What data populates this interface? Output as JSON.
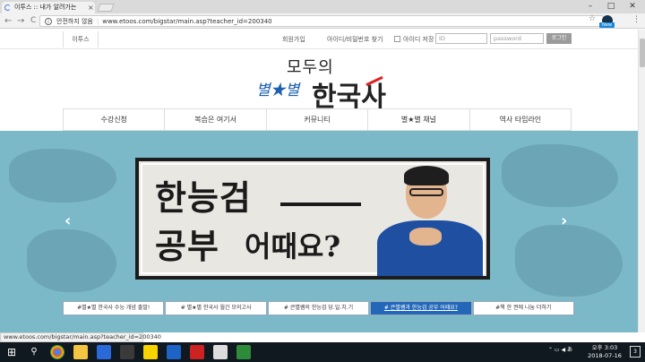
{
  "browser": {
    "tab_title": "이투스 :: 내가 알려가는",
    "tab_close": "×",
    "win_min": "–",
    "win_max": "□",
    "win_close": "✕",
    "back": "←",
    "forward": "→",
    "reload": "C",
    "security_label": "안전하지 않음",
    "url": "www.etoos.com/bigstar/main.asp?teacher_id=200340",
    "star": "☆",
    "new_badge": "New",
    "menu": "⋮"
  },
  "topbar": {
    "breadcrumb": "이투스",
    "signup": "회원가입",
    "find_account": "아이디/비밀번호 찾기",
    "save_id": "아이디 저장",
    "id_placeholder": "ID",
    "pw_placeholder": "password",
    "login_label": "로그인"
  },
  "logo": {
    "top": "모두의",
    "stars": "별★별",
    "main": "한국사"
  },
  "nav": [
    "수강신청",
    "복습은 여기서",
    "커뮤니티",
    "별★별 채널",
    "역사 타임라인"
  ],
  "hero": {
    "line1": "한능검",
    "line2a": "공부",
    "line2b": "어때요?",
    "prev": "‹",
    "next": "›",
    "tabs": [
      "#별★별 한국사 수능 개념 출발!",
      "# 별★별 한국사 월간 모의고사",
      "# 큰별쌤의 한능검 당.일.치.기",
      "# 큰별쌤과 한능검 공부 어때요?",
      "#책 한 권에 나눔 더하기"
    ],
    "active_tab": 3
  },
  "status_url": "www.etoos.com/bigstar/main.asp?teacher_id=200340",
  "taskbar": {
    "start": "⊞",
    "tray": "⌃ ▭ ◀ あ",
    "time": "오후 3:03",
    "date": "2018-07-16",
    "notifications": "3"
  }
}
